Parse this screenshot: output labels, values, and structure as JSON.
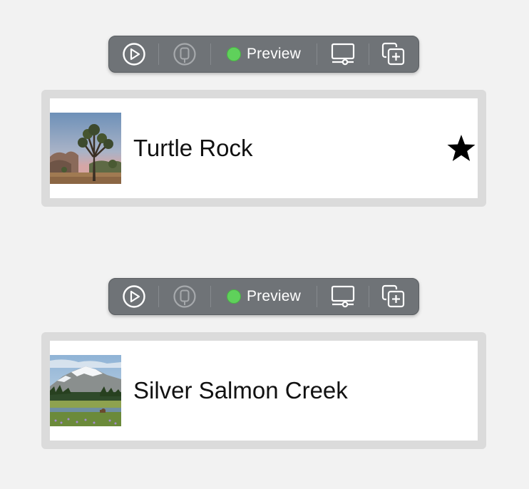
{
  "previews": [
    {
      "toolbar": {
        "live_icon": "play-circle-icon",
        "selectable_icon": "selectable-pointer-icon",
        "status_color": "#5fd15b",
        "preview_label": "Preview",
        "device_icon": "device-settings-icon",
        "duplicate_icon": "duplicate-plus-icon"
      },
      "row": {
        "thumbnail": "joshua-tree-photo",
        "title": "Turtle Rock",
        "favorite": true,
        "favorite_icon": "star-filled-icon"
      }
    },
    {
      "toolbar": {
        "live_icon": "play-circle-icon",
        "selectable_icon": "selectable-pointer-icon",
        "status_color": "#5fd15b",
        "preview_label": "Preview",
        "device_icon": "device-settings-icon",
        "duplicate_icon": "duplicate-plus-icon"
      },
      "row": {
        "thumbnail": "mountain-meadow-photo",
        "title": "Silver Salmon Creek",
        "favorite": false
      }
    }
  ]
}
